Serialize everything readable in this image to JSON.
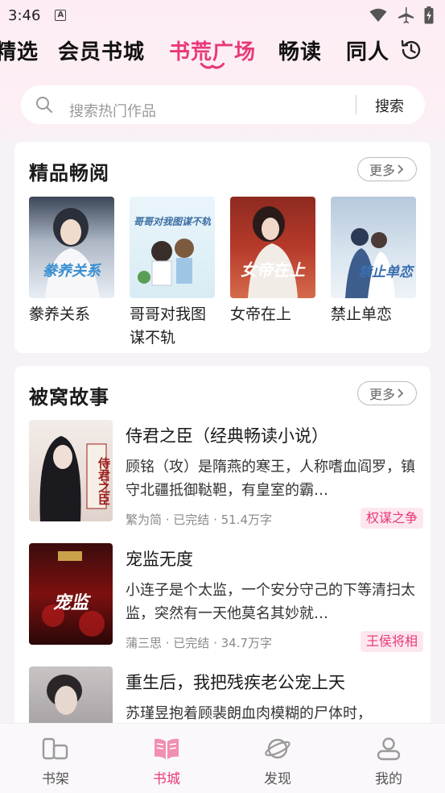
{
  "status_bar": {
    "time": "3:46",
    "notif": "A"
  },
  "tabs": [
    {
      "label": "精选"
    },
    {
      "label": "会员书城"
    },
    {
      "label": "书荒广场",
      "active": true
    },
    {
      "label": "畅读"
    },
    {
      "label": "同人"
    }
  ],
  "search": {
    "placeholder": "搜索热门作品",
    "button": "搜索"
  },
  "featured": {
    "title": "精品畅阅",
    "more": "更多",
    "books": [
      {
        "name": "豢养关系",
        "cover_text": "豢养关系"
      },
      {
        "name": "哥哥对我图谋不轨",
        "cover_text": "哥哥对我图谋不轨"
      },
      {
        "name": "女帝在上",
        "cover_text": "女帝在上"
      },
      {
        "name": "禁止单恋",
        "cover_text": "禁止单恋"
      }
    ]
  },
  "stories": {
    "title": "被窝故事",
    "more": "更多",
    "items": [
      {
        "title": "侍君之臣（经典畅读小说）",
        "desc": "顾铭（攻）是隋燕的寒王，人称嗜血阎罗，镇守北疆抵御鞑靼，有皇室的霸…",
        "meta": "繁为简 · 已完结 · 51.4万字",
        "tag": "权谋之争",
        "cover_text": "侍君之臣"
      },
      {
        "title": "宠监无度",
        "desc": "小连子是个太监，一个安分守己的下等清扫太监，突然有一天他莫名其妙就…",
        "meta": "蒲三思 · 已完结 · 34.7万字",
        "tag": "王侯将相",
        "cover_text": "宠监"
      },
      {
        "title": "重生后，我把残疾老公宠上天",
        "desc": "苏瑾昱抱着顾裴朗血肉模糊的尸体时，",
        "meta": "",
        "tag": "",
        "cover_text": ""
      }
    ]
  },
  "bottom_nav": [
    {
      "label": "书架",
      "icon": "bookshelf-icon"
    },
    {
      "label": "书城",
      "icon": "open-book-icon",
      "active": true
    },
    {
      "label": "发现",
      "icon": "planet-icon"
    },
    {
      "label": "我的",
      "icon": "person-icon"
    }
  ],
  "colors": {
    "accent": "#e8397a",
    "tag_bg": "#fde7ef"
  }
}
